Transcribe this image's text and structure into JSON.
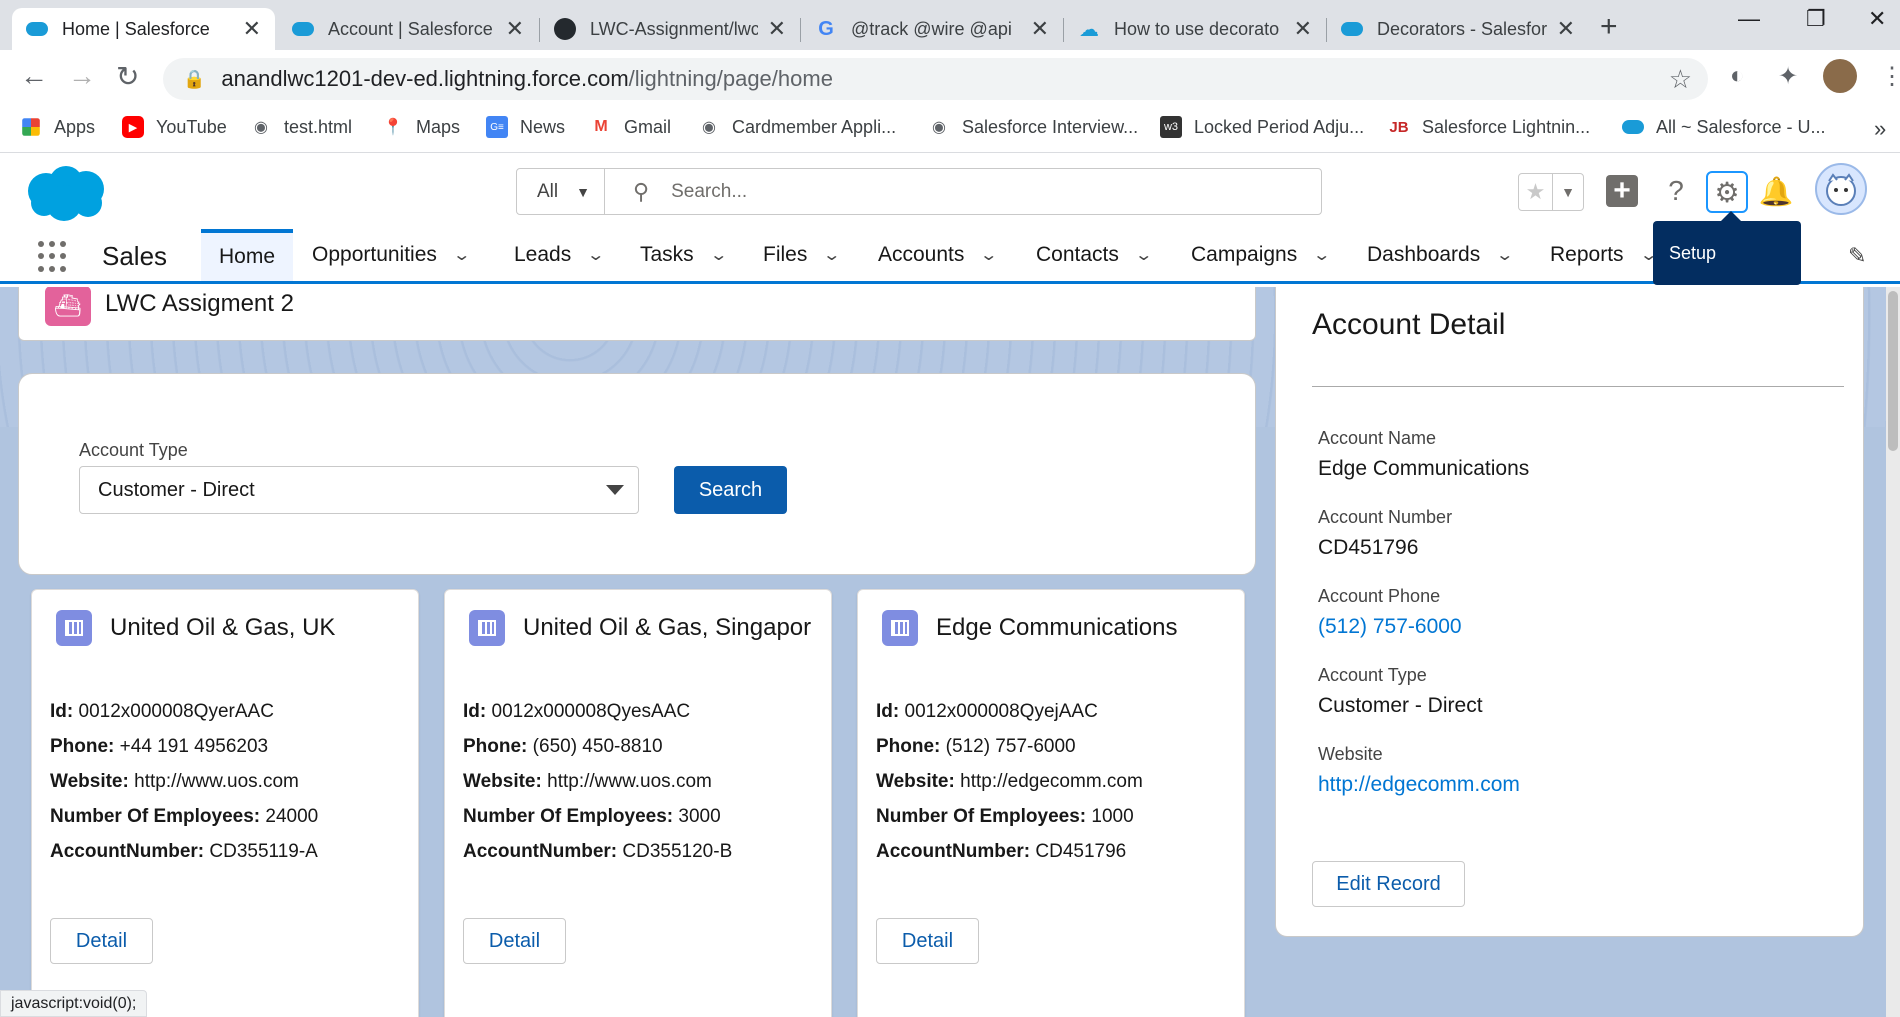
{
  "browser": {
    "tabs": [
      {
        "title": "Home | Salesforce",
        "icon": "salesforce-cloud-icon"
      },
      {
        "title": "Account | Salesforce",
        "icon": "salesforce-cloud-icon"
      },
      {
        "title": "LWC-Assignment/lwc",
        "icon": "github-icon"
      },
      {
        "title": "@track @wire @api",
        "icon": "google-icon"
      },
      {
        "title": "How to use decorato",
        "icon": "cloud-upload-icon"
      },
      {
        "title": "Decorators - Salesfor",
        "icon": "salesforce-cloud-icon"
      }
    ],
    "url_host": "anandlwc1201-dev-ed.lightning.force.com",
    "url_path": "/lightning/page/home",
    "bookmarks": [
      {
        "label": "Apps",
        "icon": "apps-grid-icon"
      },
      {
        "label": "YouTube",
        "icon": "youtube-icon"
      },
      {
        "label": "test.html",
        "icon": "globe-icon"
      },
      {
        "label": "Maps",
        "icon": "maps-pin-icon"
      },
      {
        "label": "News",
        "icon": "news-icon"
      },
      {
        "label": "Gmail",
        "icon": "gmail-icon"
      },
      {
        "label": "Cardmember Appli...",
        "icon": "globe-icon"
      },
      {
        "label": "Salesforce Interview...",
        "icon": "globe-icon"
      },
      {
        "label": "Locked Period Adju...",
        "icon": "w3-icon"
      },
      {
        "label": "Salesforce Lightnin...",
        "icon": "jb-icon"
      },
      {
        "label": "All ~ Salesforce - U...",
        "icon": "salesforce-cloud-icon"
      }
    ],
    "status_text": "javascript:void(0);"
  },
  "sf": {
    "search_scope": "All",
    "search_placeholder": "Search...",
    "app_name": "Sales",
    "nav": [
      "Home",
      "Opportunities",
      "Leads",
      "Tasks",
      "Files",
      "Accounts",
      "Contacts",
      "Campaigns",
      "Dashboards",
      "Reports"
    ],
    "setup_tooltip": "Setup"
  },
  "component": {
    "title": "LWC Assigment 2",
    "filter_label": "Account Type",
    "filter_value": "Customer - Direct",
    "search_button": "Search",
    "labels": {
      "id": "Id:",
      "phone": "Phone:",
      "website": "Website:",
      "employees": "Number Of Employees:",
      "account_number": "AccountNumber:"
    },
    "detail_button": "Detail",
    "accounts": [
      {
        "name": "United Oil & Gas, UK",
        "id": "0012x000008QyerAAC",
        "phone": "+44 191 4956203",
        "website": "http://www.uos.com",
        "employees": "24000",
        "account_number": "CD355119-A"
      },
      {
        "name": "United Oil & Gas, Singapore",
        "id": "0012x000008QyesAAC",
        "phone": "(650) 450-8810",
        "website": "http://www.uos.com",
        "employees": "3000",
        "account_number": "CD355120-B"
      },
      {
        "name": "Edge Communications",
        "id": "0012x000008QyejAAC",
        "phone": "(512) 757-6000",
        "website": "http://edgecomm.com",
        "employees": "1000",
        "account_number": "CD451796"
      }
    ]
  },
  "detail": {
    "title": "Account Detail",
    "fields": [
      {
        "label": "Account Name",
        "value": "Edge Communications"
      },
      {
        "label": "Account Number",
        "value": "CD451796"
      },
      {
        "label": "Account Phone",
        "value": "(512) 757-6000"
      },
      {
        "label": "Account Type",
        "value": "Customer - Direct"
      },
      {
        "label": "Website",
        "value": "http://edgecomm.com"
      }
    ],
    "edit_button": "Edit Record"
  },
  "colors": {
    "brand_blue": "#0176d3",
    "button_blue": "#0b5cab",
    "page_background": "#b0c4df",
    "tooltip_navy": "#032d60"
  }
}
